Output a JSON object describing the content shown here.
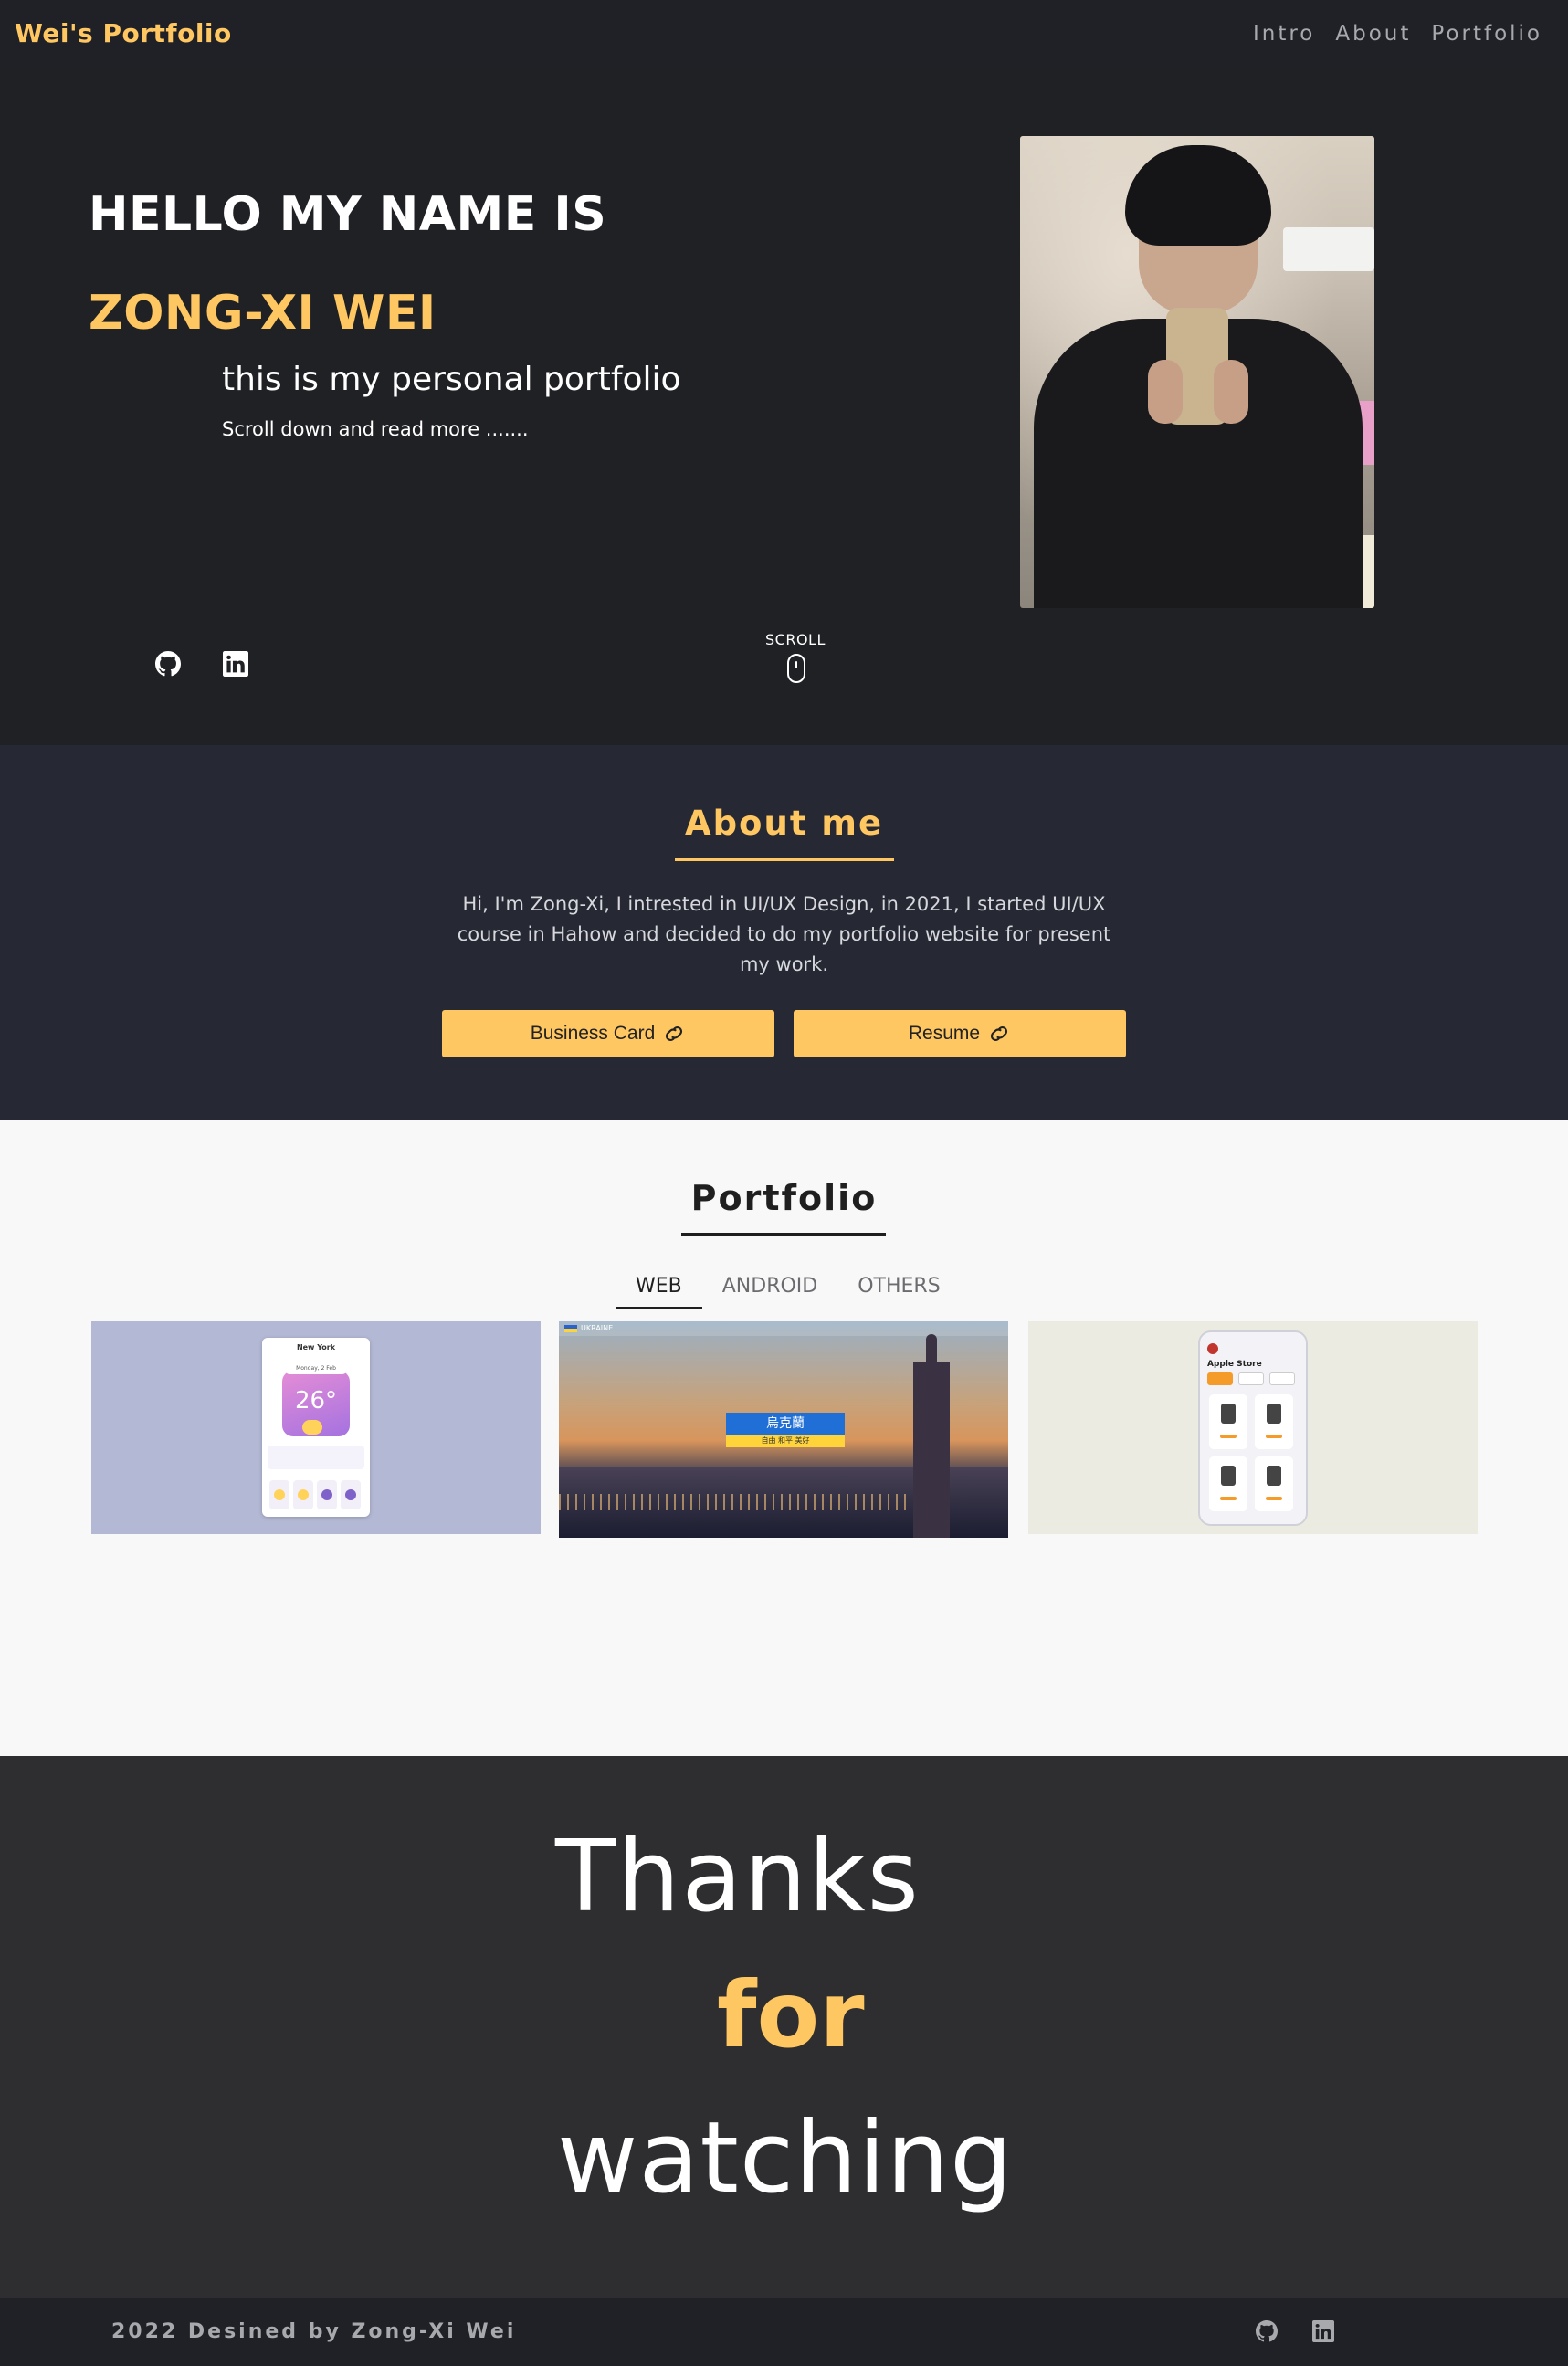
{
  "nav": {
    "brand": "Wei's Portfolio",
    "links": [
      "Intro",
      "About",
      "Portfolio"
    ]
  },
  "hero": {
    "greeting": "HELLO MY NAME IS",
    "name": "ZONG-XI WEI",
    "tagline": "this is my personal portfolio",
    "hint": "Scroll down and read more .......",
    "scroll_label": "SCROLL",
    "social_icons": [
      "github-icon",
      "linkedin-icon"
    ]
  },
  "about": {
    "title": "About me",
    "text": "Hi, I'm Zong-Xi, I intrested in UI/UX Design, in 2021, I started UI/UX course in Hahow and decided to do my portfolio website for present my work.",
    "buttons": [
      "Business Card",
      "Resume"
    ]
  },
  "portfolio": {
    "title": "Portfolio",
    "tabs": [
      "WEB",
      "ANDROID",
      "OTHERS"
    ],
    "active_tab": "WEB",
    "cards": {
      "weather": {
        "city": "New York",
        "date": "Monday, 2 Feb",
        "temp": "26°"
      },
      "ukraine": {
        "logo": "UKRAINE",
        "headline": "烏克蘭",
        "sub": "自由 和平 美好"
      },
      "store": {
        "title": "Apple Store"
      }
    }
  },
  "thanks": {
    "line1": "Thanks",
    "line2": "for",
    "line3": "watching"
  },
  "footer": {
    "text": "2022 Desined by Zong-Xi Wei"
  },
  "colors": {
    "accent": "#ffc761",
    "nav_bg": "#1f2127",
    "hero_bg": "#202125",
    "about_bg": "#262833",
    "portfolio_bg": "#f8f8f8",
    "thanks_bg": "#2e2e30"
  }
}
